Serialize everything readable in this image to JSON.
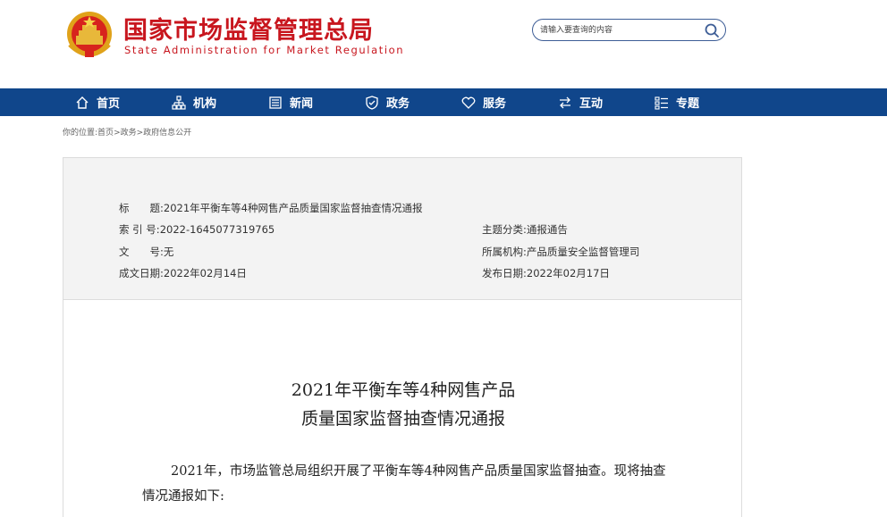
{
  "header": {
    "title": "国家市场监督管理总局",
    "subtitle": "State Administration for Market Regulation",
    "search_placeholder": "请输入要查询的内容"
  },
  "nav": {
    "items": [
      {
        "label": "首页",
        "icon": "home-icon"
      },
      {
        "label": "机构",
        "icon": "org-chart-icon"
      },
      {
        "label": "新闻",
        "icon": "newspaper-icon"
      },
      {
        "label": "政务",
        "icon": "shield-icon"
      },
      {
        "label": "服务",
        "icon": "heart-icon"
      },
      {
        "label": "互动",
        "icon": "exchange-icon"
      },
      {
        "label": "专题",
        "icon": "list-icon"
      }
    ]
  },
  "breadcrumb": {
    "prefix": "你的位置:",
    "items": [
      "首页",
      "政务",
      "政府信息公开"
    ],
    "separator": ">"
  },
  "info": {
    "title_label": "标　　题:",
    "title_value": "2021年平衡车等4种网售产品质量国家监督抽查情况通报",
    "index_label": "索 引 号:",
    "index_value": "2022-1645077319765",
    "category_label": "主题分类:",
    "category_value": "通报通告",
    "doc_no_label": "文　　号:",
    "doc_no_value": "无",
    "org_label": "所属机构:",
    "org_value": "产品质量安全监督管理司",
    "created_label": "成文日期:",
    "created_value": "2022年02月14日",
    "published_label": "发布日期:",
    "published_value": "2022年02月17日"
  },
  "article": {
    "title_line1": "2021年平衡车等4种网售产品",
    "title_line2": "质量国家监督抽查情况通报",
    "paragraph1": "2021年，市场监管总局组织开展了平衡车等4种网售产品质量国家监督抽查。现将抽查情况通报如下:"
  },
  "colors": {
    "brand_red": "#c8161e",
    "nav_blue": "#10468b",
    "info_bg": "#f3f3f3"
  }
}
